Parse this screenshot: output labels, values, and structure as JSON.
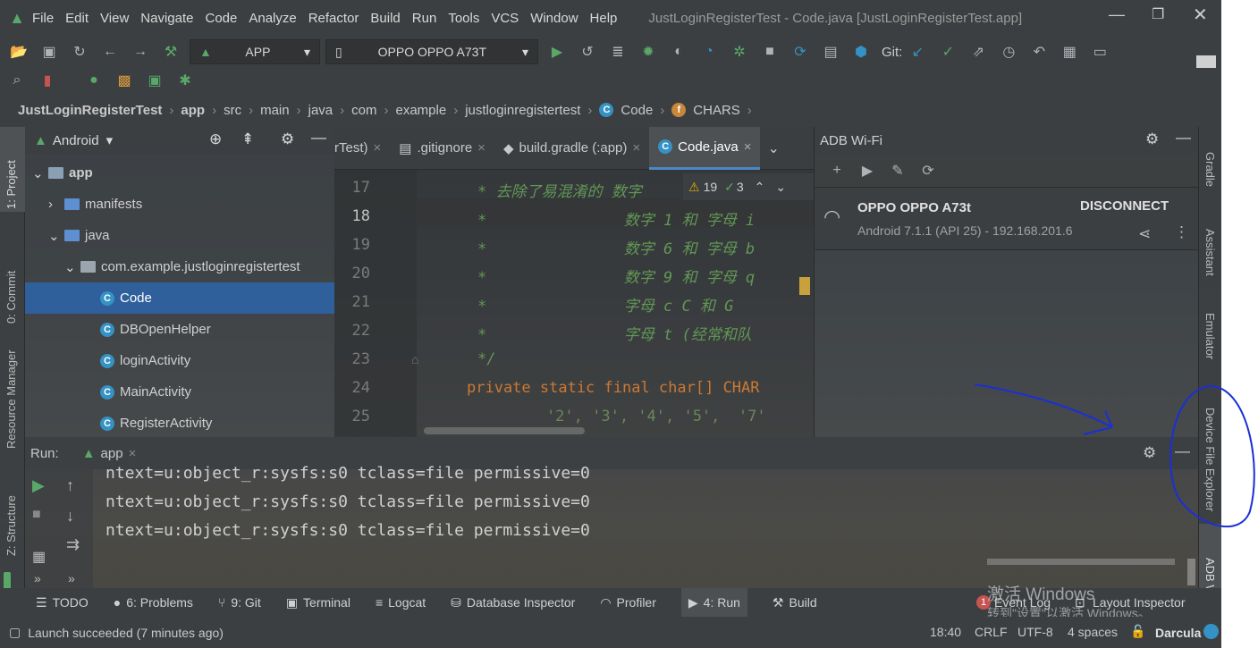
{
  "window": {
    "title": "JustLoginRegisterTest - Code.java [JustLoginRegisterTest.app]"
  },
  "menu": [
    "File",
    "Edit",
    "View",
    "Navigate",
    "Code",
    "Analyze",
    "Refactor",
    "Build",
    "Run",
    "Tools",
    "VCS",
    "Window",
    "Help"
  ],
  "toolbar": {
    "run_config": "APP",
    "device": "OPPO OPPO A73T",
    "git_label": "Git:"
  },
  "breadcrumb": [
    "JustLoginRegisterTest",
    "app",
    "src",
    "main",
    "java",
    "com",
    "example",
    "justloginregistertest",
    "Code",
    "CHARS"
  ],
  "left_tabs": {
    "project": "1: Project",
    "commit": "0: Commit",
    "resource_manager": "Resource Manager",
    "structure": "Z: Structure"
  },
  "right_tabs": {
    "gradle": "Gradle",
    "assistant": "Assistant",
    "emulator": "Emulator",
    "device_file_explorer": "Device File Explorer",
    "adb": "ADB Wi-Fi"
  },
  "project": {
    "view": "Android",
    "tree": [
      {
        "label": "app",
        "type": "module"
      },
      {
        "label": "manifests",
        "type": "folder"
      },
      {
        "label": "java",
        "type": "folder"
      },
      {
        "label": "com.example.justloginregistertest",
        "type": "package"
      },
      {
        "label": "Code",
        "type": "class",
        "selected": true
      },
      {
        "label": "DBOpenHelper",
        "type": "class"
      },
      {
        "label": "loginActivity",
        "type": "class"
      },
      {
        "label": "MainActivity",
        "type": "class"
      },
      {
        "label": "RegisterActivity",
        "type": "class"
      }
    ]
  },
  "editor": {
    "tabs": [
      "rTest)",
      ".gitignore",
      "build.gradle (:app)",
      "Code.java"
    ],
    "warnings": "19",
    "ok": "3",
    "lines": [
      {
        "n": "17",
        "t": "* 去除了易混淆的 数字"
      },
      {
        "n": "18",
        "t": "*               数字 1 和 字母 i"
      },
      {
        "n": "19",
        "t": "*               数字 6 和 字母 b"
      },
      {
        "n": "20",
        "t": "*               数字 9 和 字母 q"
      },
      {
        "n": "21",
        "t": "*               字母 c C 和 G"
      },
      {
        "n": "22",
        "t": "*               字母 t (经常和队"
      },
      {
        "n": "23",
        "t": "*/"
      },
      {
        "n": "24",
        "t": "private static final char[] CHAR"
      },
      {
        "n": "25",
        "t": "    '2', '3', '4', '5',  '7'"
      }
    ]
  },
  "adb": {
    "title": "ADB Wi-Fi",
    "device": "OPPO OPPO A73t",
    "detail": "Android 7.1.1 (API 25) - 192.168.201.6",
    "disconnect": "DISCONNECT"
  },
  "run": {
    "label": "Run:",
    "tab": "app",
    "lines": [
      "ntext=u:object_r:sysfs:s0 tclass=file permissive=0",
      "ntext=u:object_r:sysfs:s0 tclass=file permissive=0",
      "ntext=u:object_r:sysfs:s0 tclass=file permissive=0"
    ]
  },
  "bottom_tabs": [
    "TODO",
    "6: Problems",
    "9: Git",
    "Terminal",
    "Logcat",
    "Database Inspector",
    "Profiler",
    "4: Run",
    "Build"
  ],
  "bottom_right": {
    "event_log": "Event Log",
    "event_count": "1",
    "layout_inspector": "Layout Inspector"
  },
  "watermark": {
    "line1": "激活 Windows",
    "line2": "转到\"设置\"以激活 Windows。"
  },
  "status": {
    "message": "Launch succeeded (7 minutes ago)",
    "position": "18:40",
    "line_sep": "CRLF",
    "encoding": "UTF-8",
    "indent": "4 spaces",
    "theme": "Darcula"
  },
  "colors": {
    "accent": "#3592c4",
    "green": "#59a869",
    "annotation": "#1a2fd6"
  }
}
